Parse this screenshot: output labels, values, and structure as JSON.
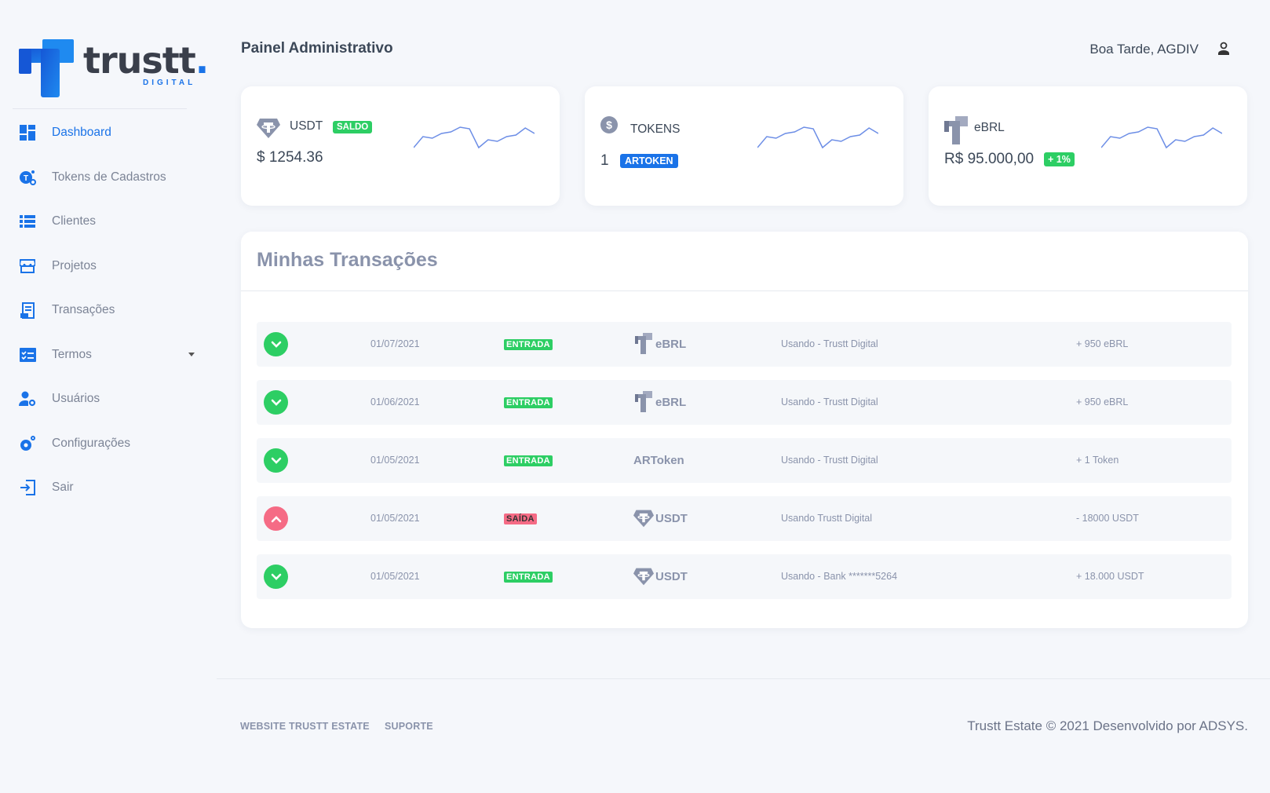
{
  "brand": {
    "name": "trustt",
    "dot": ".",
    "sub": "DIGITAL",
    "accent": "#1a73e8"
  },
  "header": {
    "title": "Painel Administrativo",
    "greeting": "Boa Tarde, AGDIV",
    "user_icon": "user-icon"
  },
  "sidebar": {
    "items": [
      {
        "label": "Dashboard",
        "icon": "dashboard-icon",
        "active": true
      },
      {
        "label": "Tokens de Cadastros",
        "icon": "token-gear-icon"
      },
      {
        "label": "Clientes",
        "icon": "list-icon"
      },
      {
        "label": "Projetos",
        "icon": "store-icon"
      },
      {
        "label": "Transações",
        "icon": "receipt-icon"
      },
      {
        "label": "Termos",
        "icon": "checklist-icon",
        "has_submenu": true
      },
      {
        "label": "Usuários",
        "icon": "user-settings-icon"
      },
      {
        "label": "Configurações",
        "icon": "gears-icon"
      },
      {
        "label": "Sair",
        "icon": "logout-icon"
      }
    ]
  },
  "cards": [
    {
      "title": "USDT",
      "badge": "SALDO",
      "value": "$ 1254.36",
      "icon": "tether-icon"
    },
    {
      "title": "TOKENS",
      "count": "1",
      "badge": "ARTOKEN",
      "icon": "dollar-circle-icon"
    },
    {
      "title": "eBRL",
      "value": "R$ 95.000,00",
      "badge": "+ 1%",
      "icon": "ebrl-icon"
    }
  ],
  "sparkline": [
    30,
    16,
    18,
    12,
    10,
    4,
    6,
    30,
    20,
    22,
    16,
    14,
    5,
    12
  ],
  "transactions": {
    "title": "Minhas Transações",
    "rows": [
      {
        "direction": "in",
        "date": "01/07/2021",
        "type": "ENTRADA",
        "asset": "eBRL",
        "asset_icon": "ebrl-icon",
        "desc": "Usando - Trustt Digital",
        "amount": "+ 950 eBRL"
      },
      {
        "direction": "in",
        "date": "01/06/2021",
        "type": "ENTRADA",
        "asset": "eBRL",
        "asset_icon": "ebrl-icon",
        "desc": "Usando - Trustt Digital",
        "amount": "+ 950 eBRL"
      },
      {
        "direction": "in",
        "date": "01/05/2021",
        "type": "ENTRADA",
        "asset": "ARToken",
        "asset_icon": "",
        "desc": "Usando - Trustt Digital",
        "amount": "+ 1 Token"
      },
      {
        "direction": "out",
        "date": "01/05/2021",
        "type": "SAÍDA",
        "asset": "USDT",
        "asset_icon": "tether-icon",
        "desc": "Usando Trustt Digital",
        "amount": "- 18000 USDT"
      },
      {
        "direction": "in",
        "date": "01/05/2021",
        "type": "ENTRADA",
        "asset": "USDT",
        "asset_icon": "tether-icon",
        "desc": "Usando - Bank *******5264",
        "amount": "+ 18.000 USDT"
      }
    ]
  },
  "footer": {
    "links": [
      "WEBSITE TRUSTT ESTATE",
      "SUPORTE"
    ],
    "copyright": "Trustt Estate © 2021 Desenvolvido por ADSYS."
  },
  "colors": {
    "green": "#2dce64",
    "red": "#f56b85",
    "blue": "#1a73e8",
    "muted": "#8a93ab"
  }
}
